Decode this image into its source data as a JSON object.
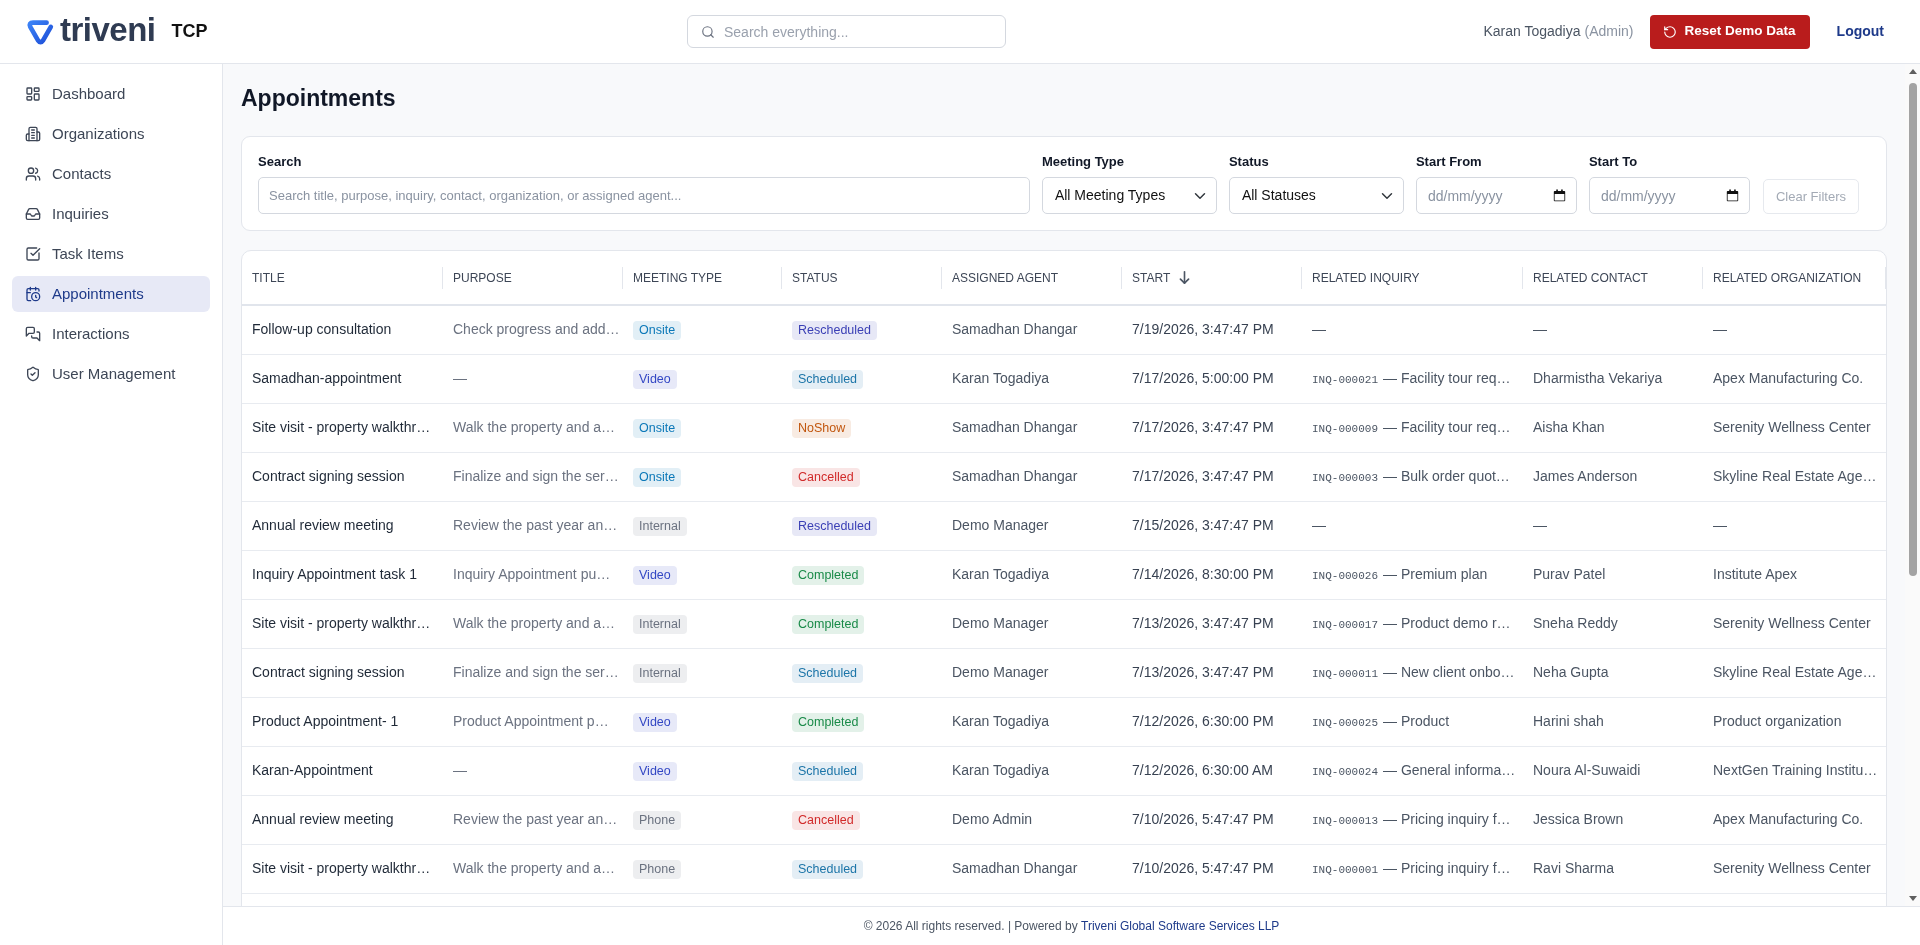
{
  "header": {
    "logo_text": "triveni",
    "app_name": "TCP",
    "search": {
      "placeholder": "Search everything..."
    },
    "user": {
      "name": "Karan Togadiya",
      "role": "(Admin)"
    },
    "reset_button": "Reset Demo Data",
    "logout": "Logout"
  },
  "sidebar": {
    "items": [
      {
        "label": "Dashboard",
        "selected": false
      },
      {
        "label": "Organizations",
        "selected": false
      },
      {
        "label": "Contacts",
        "selected": false
      },
      {
        "label": "Inquiries",
        "selected": false
      },
      {
        "label": "Task Items",
        "selected": false
      },
      {
        "label": "Appointments",
        "selected": true
      },
      {
        "label": "Interactions",
        "selected": false
      },
      {
        "label": "User Management",
        "selected": false
      }
    ]
  },
  "page_title": "Appointments",
  "filters": {
    "search": {
      "label": "Search",
      "placeholder": "Search title, purpose, inquiry, contact, organization, or assigned agent..."
    },
    "meeting_type": {
      "label": "Meeting Type",
      "value": "All Meeting Types"
    },
    "status": {
      "label": "Status",
      "value": "All Statuses"
    },
    "start_from": {
      "label": "Start From",
      "placeholder": "dd/mm/yyyy"
    },
    "start_to": {
      "label": "Start To",
      "placeholder": "dd/mm/yyyy"
    },
    "clear_button": {
      "label": "Clear Filters",
      "disabled": true
    }
  },
  "table": {
    "columns": [
      {
        "label": "TITLE",
        "sorted": false
      },
      {
        "label": "PURPOSE",
        "sorted": false
      },
      {
        "label": "MEETING TYPE",
        "sorted": false
      },
      {
        "label": "STATUS",
        "sorted": false
      },
      {
        "label": "ASSIGNED AGENT",
        "sorted": false
      },
      {
        "label": "START",
        "sorted": true,
        "descending": true
      },
      {
        "label": "RELATED INQUIRY",
        "sorted": false
      },
      {
        "label": "RELATED CONTACT",
        "sorted": false
      },
      {
        "label": "RELATED ORGANIZATION",
        "sorted": false
      }
    ],
    "rows": [
      {
        "title": "Follow-up consultation",
        "purpose": "Check progress and add…",
        "meeting_type": {
          "label": "Onsite",
          "color": "#0b78b8"
        },
        "status": {
          "label": "Rescheduled",
          "color": "#3a3fb5"
        },
        "assigned_agent": "Samadhan Dhangar",
        "start": "7/19/2026, 3:47:47 PM",
        "related_inquiry": {
          "summary": "—"
        },
        "related_contact": "—",
        "related_organization": "—"
      },
      {
        "title": "Samadhan-appointment",
        "purpose": "—",
        "meeting_type": {
          "label": "Video",
          "color": "#3347c4"
        },
        "status": {
          "label": "Scheduled",
          "color": "#1c75a8"
        },
        "assigned_agent": "Karan Togadiya",
        "start": "7/17/2026, 5:00:00 PM",
        "related_inquiry": {
          "code": "INQ-000021",
          "summary": "— Facility tour req…"
        },
        "related_contact": "Dharmistha Vekariya",
        "related_organization": "Apex Manufacturing Co."
      },
      {
        "title": "Site visit - property walkthr…",
        "purpose": "Walk the property and a…",
        "meeting_type": {
          "label": "Onsite",
          "color": "#0b78b8"
        },
        "status": {
          "label": "NoShow",
          "color": "#c2570f"
        },
        "assigned_agent": "Samadhan Dhangar",
        "start": "7/17/2026, 3:47:47 PM",
        "related_inquiry": {
          "code": "INQ-000009",
          "summary": "— Facility tour req…"
        },
        "related_contact": "Aisha Khan",
        "related_organization": "Serenity Wellness Center"
      },
      {
        "title": "Contract signing session",
        "purpose": "Finalize and sign the ser…",
        "meeting_type": {
          "label": "Onsite",
          "color": "#0b78b8"
        },
        "status": {
          "label": "Cancelled",
          "color": "#d12a2a"
        },
        "assigned_agent": "Samadhan Dhangar",
        "start": "7/17/2026, 3:47:47 PM",
        "related_inquiry": {
          "code": "INQ-000003",
          "summary": "— Bulk order quot…"
        },
        "related_contact": "James Anderson",
        "related_organization": "Skyline Real Estate Age…"
      },
      {
        "title": "Annual review meeting",
        "purpose": "Review the past year an…",
        "meeting_type": {
          "label": "Internal",
          "color": "#6b7280"
        },
        "status": {
          "label": "Rescheduled",
          "color": "#3a3fb5"
        },
        "assigned_agent": "Demo Manager",
        "start": "7/15/2026, 3:47:47 PM",
        "related_inquiry": {
          "summary": "—"
        },
        "related_contact": "—",
        "related_organization": "—"
      },
      {
        "title": "Inquiry Appointment task 1",
        "purpose": "Inquiry Appointment pu…",
        "meeting_type": {
          "label": "Video",
          "color": "#3347c4"
        },
        "status": {
          "label": "Completed",
          "color": "#198a48"
        },
        "assigned_agent": "Karan Togadiya",
        "start": "7/14/2026, 8:30:00 PM",
        "related_inquiry": {
          "code": "INQ-000026",
          "summary": "— Premium plan"
        },
        "related_contact": "Purav Patel",
        "related_organization": "Institute Apex"
      },
      {
        "title": "Site visit - property walkthr…",
        "purpose": "Walk the property and a…",
        "meeting_type": {
          "label": "Internal",
          "color": "#6b7280"
        },
        "status": {
          "label": "Completed",
          "color": "#198a48"
        },
        "assigned_agent": "Demo Manager",
        "start": "7/13/2026, 3:47:47 PM",
        "related_inquiry": {
          "code": "INQ-000017",
          "summary": "— Product demo r…"
        },
        "related_contact": "Sneha Reddy",
        "related_organization": "Serenity Wellness Center"
      },
      {
        "title": "Contract signing session",
        "purpose": "Finalize and sign the ser…",
        "meeting_type": {
          "label": "Internal",
          "color": "#6b7280"
        },
        "status": {
          "label": "Scheduled",
          "color": "#1c75a8"
        },
        "assigned_agent": "Demo Manager",
        "start": "7/13/2026, 3:47:47 PM",
        "related_inquiry": {
          "code": "INQ-000011",
          "summary": "— New client onbo…"
        },
        "related_contact": "Neha Gupta",
        "related_organization": "Skyline Real Estate Age…"
      },
      {
        "title": "Product Appointment- 1",
        "purpose": "Product Appointment p…",
        "meeting_type": {
          "label": "Video",
          "color": "#3347c4"
        },
        "status": {
          "label": "Completed",
          "color": "#198a48"
        },
        "assigned_agent": "Karan Togadiya",
        "start": "7/12/2026, 6:30:00 PM",
        "related_inquiry": {
          "code": "INQ-000025",
          "summary": "— Product"
        },
        "related_contact": "Harini shah",
        "related_organization": "Product organization"
      },
      {
        "title": "Karan-Appointment",
        "purpose": "—",
        "meeting_type": {
          "label": "Video",
          "color": "#3347c4"
        },
        "status": {
          "label": "Scheduled",
          "color": "#1c75a8"
        },
        "assigned_agent": "Karan Togadiya",
        "start": "7/12/2026, 6:30:00 AM",
        "related_inquiry": {
          "code": "INQ-000024",
          "summary": "— General informa…"
        },
        "related_contact": "Noura Al-Suwaidi",
        "related_organization": "NextGen Training Institu…"
      },
      {
        "title": "Annual review meeting",
        "purpose": "Review the past year an…",
        "meeting_type": {
          "label": "Phone",
          "color": "#6b7280"
        },
        "status": {
          "label": "Cancelled",
          "color": "#d12a2a"
        },
        "assigned_agent": "Demo Admin",
        "start": "7/10/2026, 5:47:47 PM",
        "related_inquiry": {
          "code": "INQ-000013",
          "summary": "— Pricing inquiry f…"
        },
        "related_contact": "Jessica Brown",
        "related_organization": "Apex Manufacturing Co."
      },
      {
        "title": "Site visit - property walkthr…",
        "purpose": "Walk the property and a…",
        "meeting_type": {
          "label": "Phone",
          "color": "#6b7280"
        },
        "status": {
          "label": "Scheduled",
          "color": "#1c75a8"
        },
        "assigned_agent": "Samadhan Dhangar",
        "start": "7/10/2026, 5:47:47 PM",
        "related_inquiry": {
          "code": "INQ-000001",
          "summary": "— Pricing inquiry f…"
        },
        "related_contact": "Ravi Sharma",
        "related_organization": "Serenity Wellness Center"
      }
    ]
  },
  "footer": {
    "text": "© 2026 All rights reserved. | Powered by ",
    "link": "Triveni Global Software Services LLP"
  }
}
